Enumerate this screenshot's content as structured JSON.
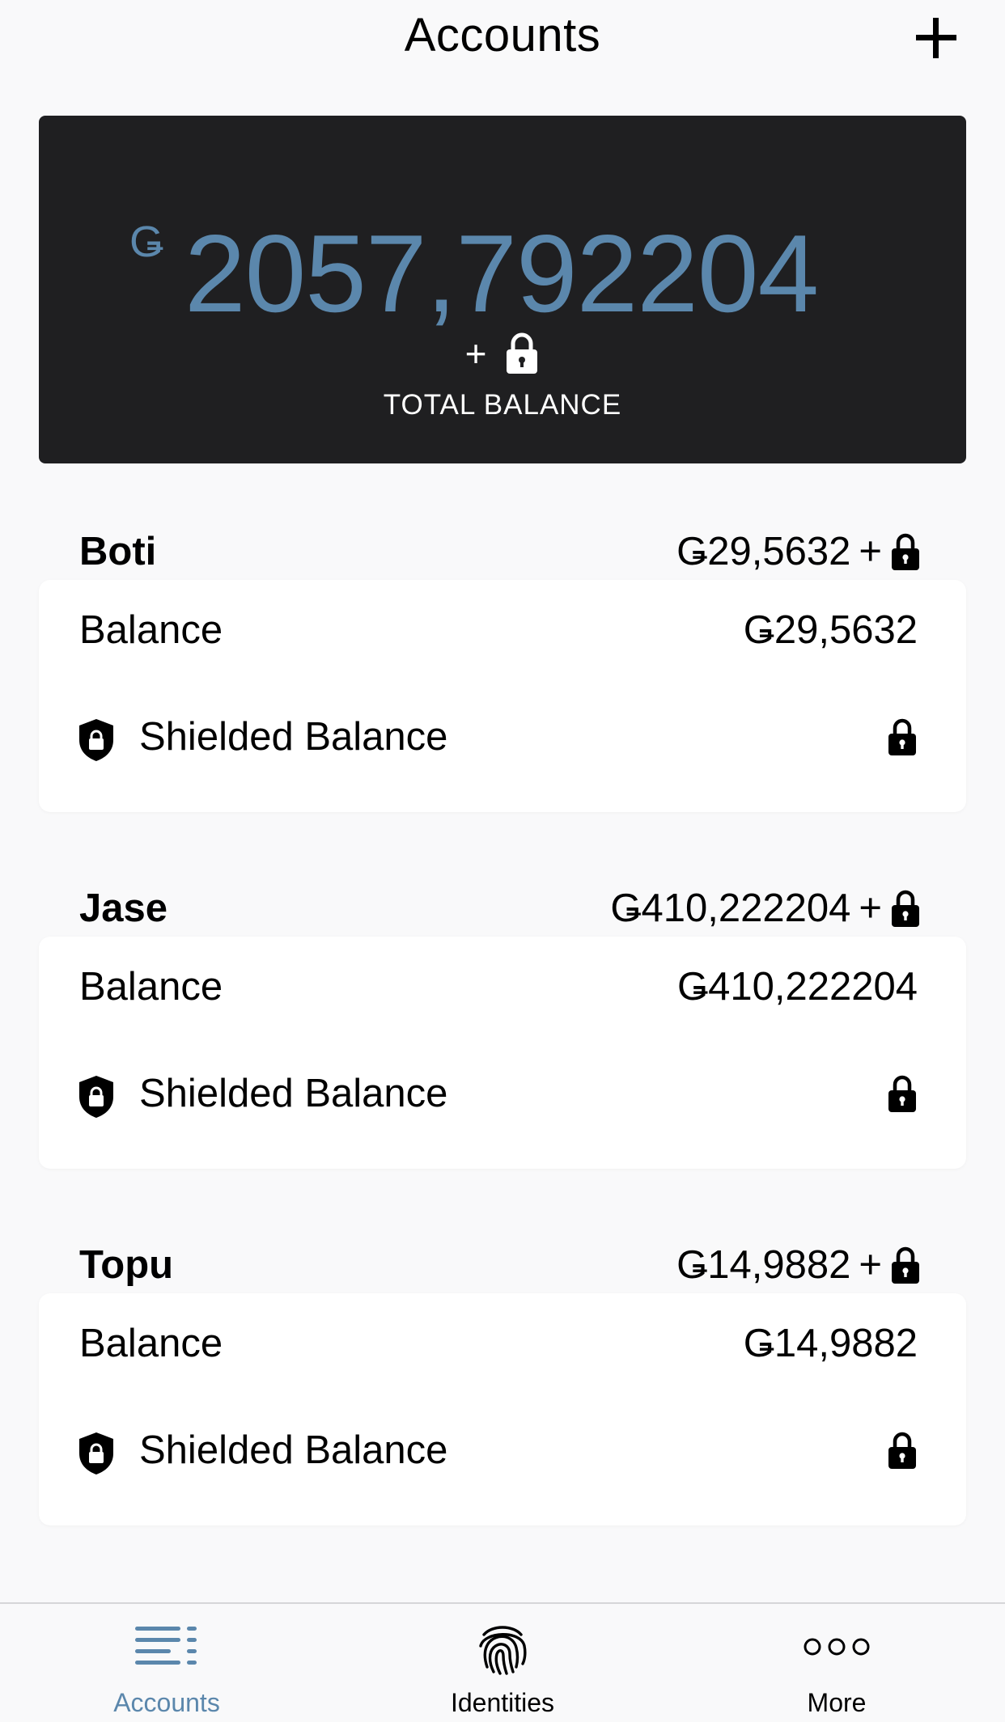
{
  "header": {
    "title": "Accounts",
    "add_icon": "plus-icon"
  },
  "total": {
    "currency_symbol": "Ǥ",
    "amount": "2057,792204",
    "plus": "+",
    "lock_icon": "lock-icon",
    "label": "TOTAL BALANCE",
    "amount_color": "#5b87ac"
  },
  "accounts": [
    {
      "name": "Boti",
      "summary_amount": "Ǥ29,5632",
      "summary_plus": "+",
      "balance_label": "Balance",
      "balance_value": "Ǥ29,5632",
      "shielded_label": "Shielded Balance"
    },
    {
      "name": "Jase",
      "summary_amount": "Ǥ410,222204",
      "summary_plus": "+",
      "balance_label": "Balance",
      "balance_value": "Ǥ410,222204",
      "shielded_label": "Shielded Balance"
    },
    {
      "name": "Topu",
      "summary_amount": "Ǥ14,9882",
      "summary_plus": "+",
      "balance_label": "Balance",
      "balance_value": "Ǥ14,9882",
      "shielded_label": "Shielded Balance"
    }
  ],
  "nav": {
    "items": [
      {
        "label": "Accounts",
        "icon": "accounts-list-icon",
        "active": true
      },
      {
        "label": "Identities",
        "icon": "fingerprint-icon",
        "active": false
      },
      {
        "label": "More",
        "icon": "more-dots-icon",
        "active": false
      }
    ],
    "active_color": "#5b87ac"
  }
}
